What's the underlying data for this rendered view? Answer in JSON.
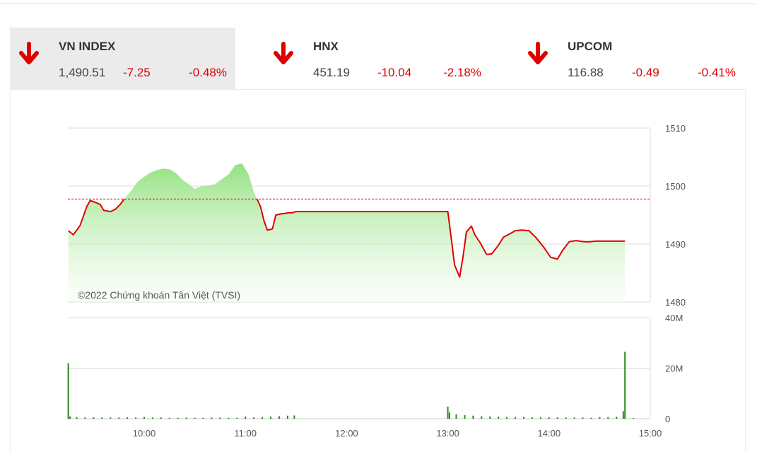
{
  "indices": [
    {
      "name": "VN INDEX",
      "price": "1,490.51",
      "change": "-7.25",
      "percent": "-0.48%",
      "direction": "down",
      "active": true
    },
    {
      "name": "HNX",
      "price": "451.19",
      "change": "-10.04",
      "percent": "-2.18%",
      "direction": "down",
      "active": false
    },
    {
      "name": "UPCOM",
      "price": "116.88",
      "change": "-0.49",
      "percent": "-0.41%",
      "direction": "down",
      "active": false
    }
  ],
  "colors": {
    "down": "#e00000",
    "area_top": "#8ee07a",
    "area_bottom": "#f4fdf1",
    "volume": "#2a8a1e",
    "reference_line": "#e00000",
    "grid": "#dddddd"
  },
  "icons": {
    "down": "arrow-down-icon"
  },
  "chart_data": {
    "type": "line",
    "watermark": "©2022 Chứng khoán Tân Việt (TVSI)",
    "price": {
      "reference": 1497.76,
      "ylim": [
        1480,
        1510
      ],
      "y_ticks": [
        "1510",
        "1500",
        "1490",
        "1480"
      ],
      "series": {
        "x": [
          "09:15",
          "09:18",
          "09:22",
          "09:26",
          "09:28",
          "09:31",
          "09:34",
          "09:36",
          "09:40",
          "09:43",
          "09:46",
          "09:48",
          "09:52",
          "09:56",
          "09:59",
          "10:03",
          "10:07",
          "10:11",
          "10:15",
          "10:19",
          "10:23",
          "10:27",
          "10:30",
          "10:34",
          "10:38",
          "10:42",
          "10:46",
          "10:50",
          "10:54",
          "10:58",
          "11:02",
          "11:05",
          "11:09",
          "11:11",
          "11:13",
          "11:16",
          "11:18",
          "11:21",
          "11:24",
          "11:26",
          "11:28",
          "11:30",
          "13:00",
          "13:02",
          "13:04",
          "13:07",
          "13:09",
          "13:11",
          "13:14",
          "13:16",
          "13:19",
          "13:23",
          "13:26",
          "13:30",
          "13:33",
          "13:37",
          "13:40",
          "13:44",
          "13:48",
          "13:52",
          "13:57",
          "14:01",
          "14:05",
          "14:08",
          "14:12",
          "14:16",
          "14:18",
          "14:21",
          "14:24",
          "14:28",
          "14:30",
          "14:32",
          "14:45"
        ],
        "values": [
          1492.3,
          1491.6,
          1493.2,
          1496.5,
          1497.5,
          1497.2,
          1496.8,
          1495.8,
          1495.6,
          1496.0,
          1496.9,
          1497.7,
          1499.1,
          1500.7,
          1501.4,
          1502.2,
          1502.7,
          1503.0,
          1502.9,
          1502.2,
          1501.0,
          1500.2,
          1499.5,
          1500.0,
          1500.1,
          1500.3,
          1501.2,
          1502.0,
          1503.6,
          1503.9,
          1501.9,
          1499.0,
          1496.4,
          1494.0,
          1492.4,
          1492.6,
          1495.0,
          1495.2,
          1495.3,
          1495.4,
          1495.4,
          1495.6,
          1495.6,
          1491.0,
          1486.4,
          1484.3,
          1487.8,
          1492.1,
          1493.1,
          1491.6,
          1490.3,
          1488.2,
          1488.3,
          1489.8,
          1491.2,
          1491.8,
          1492.3,
          1492.4,
          1492.3,
          1491.2,
          1489.4,
          1487.7,
          1487.4,
          1488.9,
          1490.4,
          1490.6,
          1490.5,
          1490.4,
          1490.4,
          1490.5,
          1490.5,
          1490.5,
          1490.5
        ]
      }
    },
    "volume": {
      "ylim": [
        0,
        40000000
      ],
      "y_ticks": [
        "40M",
        "20M",
        "0"
      ],
      "series": {
        "x": [
          "09:15",
          "09:16",
          "09:20",
          "09:25",
          "09:30",
          "09:35",
          "09:40",
          "09:45",
          "09:50",
          "09:55",
          "10:00",
          "10:05",
          "10:10",
          "10:15",
          "10:20",
          "10:25",
          "10:30",
          "10:35",
          "10:40",
          "10:45",
          "10:50",
          "10:55",
          "11:00",
          "11:05",
          "11:10",
          "11:15",
          "11:20",
          "11:25",
          "11:29",
          "13:00",
          "13:01",
          "13:05",
          "13:10",
          "13:15",
          "13:20",
          "13:25",
          "13:30",
          "13:35",
          "13:40",
          "13:45",
          "13:50",
          "13:55",
          "14:00",
          "14:05",
          "14:10",
          "14:15",
          "14:20",
          "14:25",
          "14:30",
          "14:35",
          "14:40",
          "14:44",
          "14:45",
          "14:50"
        ],
        "values": [
          22000000,
          900000,
          700000,
          600000,
          600000,
          500000,
          500000,
          500000,
          600000,
          500000,
          700000,
          500000,
          500000,
          400000,
          400000,
          500000,
          400000,
          400000,
          500000,
          500000,
          400000,
          400000,
          900000,
          600000,
          700000,
          900000,
          1000000,
          1200000,
          1300000,
          4800000,
          2500000,
          1800000,
          1400000,
          1200000,
          1000000,
          900000,
          800000,
          700000,
          700000,
          700000,
          600000,
          600000,
          600000,
          600000,
          500000,
          500000,
          500000,
          400000,
          700000,
          700000,
          800000,
          3000000,
          26500000,
          300000
        ]
      }
    },
    "x_ticks": [
      "10:00",
      "11:00",
      "12:00",
      "13:00",
      "14:00",
      "15:00"
    ]
  }
}
